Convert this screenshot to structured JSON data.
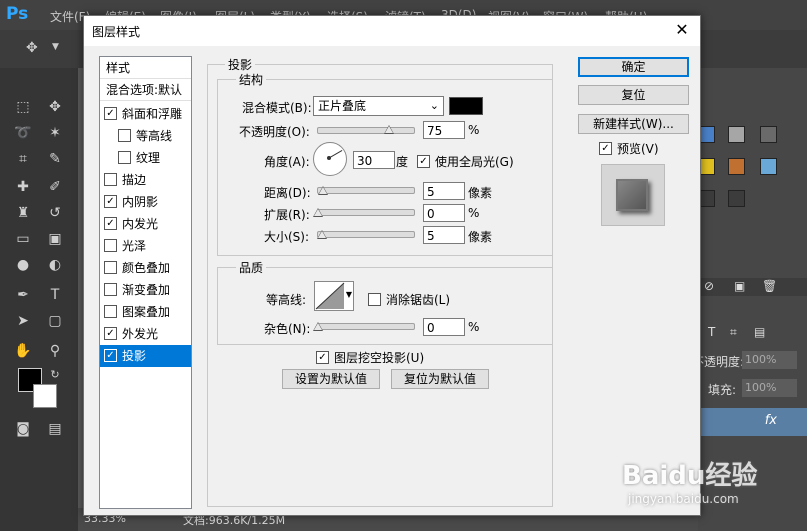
{
  "ps": {
    "logo": "Ps",
    "menu": [
      "文件(F)",
      "编辑(E)",
      "图像(I)",
      "图层(L)",
      "类型(Y)",
      "选择(S)",
      "滤镜(T)",
      "3D(D)",
      "视图(V)",
      "窗口(W)",
      "帮助(H)"
    ],
    "status_zoom": "33.33%",
    "status_doc": "文档:963.6K/1.25M",
    "panel_opacity_label": "不透明度:",
    "panel_opacity_value": "100%",
    "panel_fill_label": "填充:",
    "panel_fill_value": "100%",
    "panel_fx": "fx"
  },
  "dialog": {
    "title": "图层样式",
    "close": "✕",
    "styles_header": "样式",
    "blend_options": "混合选项:默认",
    "style_items": [
      {
        "label": "斜面和浮雕",
        "checked": "✓"
      },
      {
        "label": "等高线",
        "checked": ""
      },
      {
        "label": "纹理",
        "checked": ""
      },
      {
        "label": "描边",
        "checked": ""
      },
      {
        "label": "内阴影",
        "checked": "✓"
      },
      {
        "label": "内发光",
        "checked": "✓"
      },
      {
        "label": "光泽",
        "checked": ""
      },
      {
        "label": "颜色叠加",
        "checked": ""
      },
      {
        "label": "渐变叠加",
        "checked": ""
      },
      {
        "label": "图案叠加",
        "checked": ""
      },
      {
        "label": "外发光",
        "checked": "✓"
      },
      {
        "label": "投影",
        "checked": "✓"
      }
    ],
    "section_title": "投影",
    "structure": {
      "title": "结构",
      "blend_mode_label": "混合模式(B):",
      "blend_mode_value": "正片叠底",
      "shadow_color": "#000000",
      "opacity_label": "不透明度(O):",
      "opacity_value": "75",
      "opacity_unit": "%",
      "opacity_level": 0.75,
      "angle_label": "角度(A):",
      "angle_value": "30",
      "angle_unit": "度",
      "global_light_label": "使用全局光(G)",
      "global_light_checked": "✓",
      "distance_label": "距离(D):",
      "distance_value": "5",
      "distance_unit": "像素",
      "spread_label": "扩展(R):",
      "spread_value": "0",
      "spread_unit": "%",
      "size_label": "大小(S):",
      "size_value": "5",
      "size_unit": "像素"
    },
    "quality": {
      "title": "品质",
      "contour_label": "等高线:",
      "antialias_label": "消除锯齿(L)",
      "noise_label": "杂色(N):",
      "noise_value": "0",
      "noise_unit": "%"
    },
    "knockout_label": "图层挖空投影(U)",
    "knockout_checked": "✓",
    "make_default": "设置为默认值",
    "reset_default": "复位为默认值",
    "ok": "确定",
    "reset": "复位",
    "new_style": "新建样式(W)...",
    "preview_label": "预览(V)",
    "preview_checked": "✓"
  },
  "watermark": {
    "text": "Baidu经验",
    "url": "jingyan.baidu.com"
  }
}
